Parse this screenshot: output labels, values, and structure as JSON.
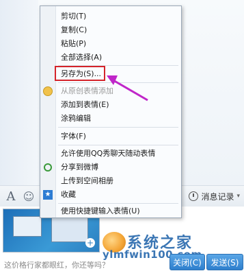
{
  "menu": {
    "items": [
      {
        "label": "剪切(T)",
        "disabled": false
      },
      {
        "label": "复制(C)",
        "disabled": false
      },
      {
        "label": "粘贴(P)",
        "disabled": false
      },
      {
        "label": "全部选择(A)",
        "disabled": false
      },
      {
        "label": "另存为(S)...",
        "disabled": false
      },
      {
        "label": "从原创表情添加",
        "disabled": true
      },
      {
        "label": "添加到表情(E)",
        "disabled": false
      },
      {
        "label": "涂鸦编辑",
        "disabled": false
      },
      {
        "label": "字体(F)",
        "disabled": false
      },
      {
        "label": "允许使用QQ秀聊天随动表情",
        "disabled": false
      },
      {
        "label": "分享到微博",
        "disabled": false
      },
      {
        "label": "上传到空间相册",
        "disabled": false
      },
      {
        "label": "收藏",
        "disabled": false
      },
      {
        "label": "使用快捷键输入表情(U)",
        "disabled": false
      }
    ]
  },
  "toolbar": {
    "font_glyph": "A",
    "emoji_glyph": "☺",
    "history_label": "消息记录",
    "dropdown_glyph": "▾"
  },
  "input": {
    "placeholder_text": "这价格行家都眼红，你还等吗？"
  },
  "buttons": {
    "close_label": "关闭(C)",
    "send_label": "发送(S)"
  },
  "watermark": {
    "brand_text": "系统之家",
    "url_text": "ylmfwin100.com"
  },
  "colors": {
    "highlight_box": "#d4232a",
    "arrow": "#c026c9",
    "button_blue": "#2e7fcd"
  }
}
